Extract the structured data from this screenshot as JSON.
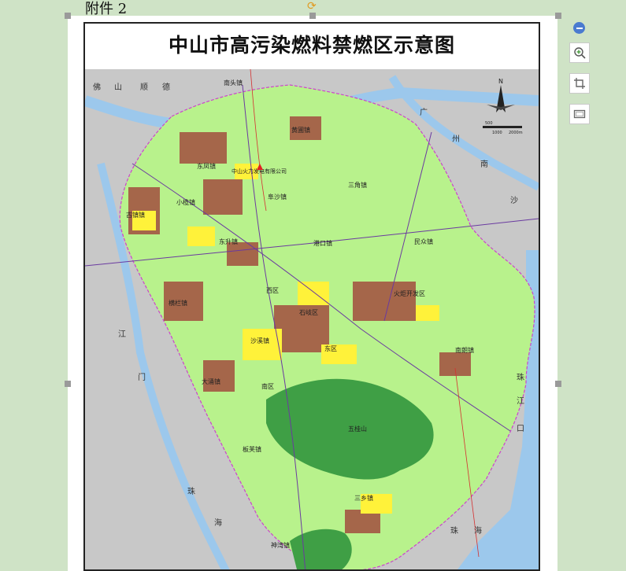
{
  "attachment_label": "附件 2",
  "map": {
    "title": "中山市高污染燃料禁燃区示意图",
    "north_label": "N",
    "scale_labels": [
      "500",
      "1000",
      "2000m"
    ],
    "towns": [
      {
        "name": "黄圃镇"
      },
      {
        "name": "阜沙镇"
      },
      {
        "name": "三角镇"
      },
      {
        "name": "东凤镇"
      },
      {
        "name": "中山火力发电有限公司"
      },
      {
        "name": "小榄镇"
      },
      {
        "name": "古镇镇"
      },
      {
        "name": "东升镇"
      },
      {
        "name": "港口镇"
      },
      {
        "name": "民众镇"
      },
      {
        "name": "西区"
      },
      {
        "name": "火炬开发区"
      },
      {
        "name": "横栏镇"
      },
      {
        "name": "石岐区"
      },
      {
        "name": "沙溪镇"
      },
      {
        "name": "东区"
      },
      {
        "name": "南朗镇"
      },
      {
        "name": "大涌镇"
      },
      {
        "name": "南区"
      },
      {
        "name": "五桂山"
      },
      {
        "name": "板芙镇"
      },
      {
        "name": "三乡镇"
      },
      {
        "name": "神湾镇"
      },
      {
        "name": "南头镇"
      }
    ],
    "regions": [
      {
        "name": "佛"
      },
      {
        "name": "山"
      },
      {
        "name": "顺"
      },
      {
        "name": "德"
      },
      {
        "name": "广"
      },
      {
        "name": "州"
      },
      {
        "name": "南"
      },
      {
        "name": "沙"
      },
      {
        "name": "江"
      },
      {
        "name": "门"
      },
      {
        "name": "珠"
      },
      {
        "name": "海"
      },
      {
        "name": "珠"
      },
      {
        "name": "江"
      },
      {
        "name": "口"
      },
      {
        "name": "珠"
      },
      {
        "name": "海"
      }
    ]
  },
  "toolbar": {
    "zoom_out": "zoom-out",
    "zoom_in": "zoom-in",
    "crop": "crop",
    "frame": "frame"
  }
}
